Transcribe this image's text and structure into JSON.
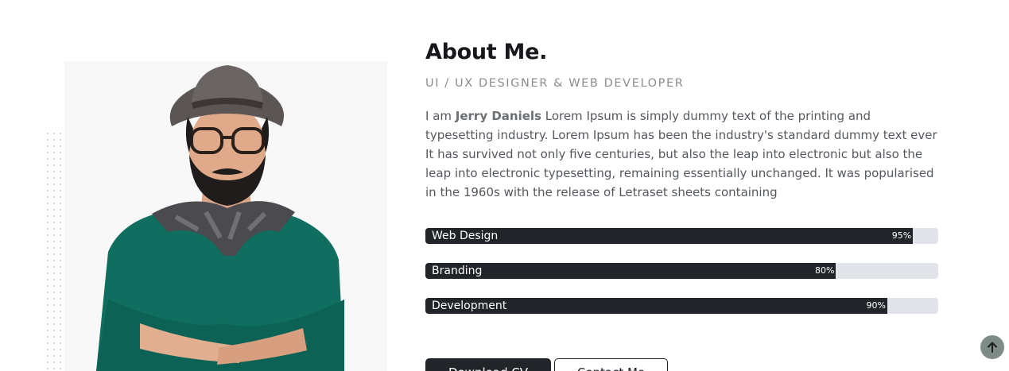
{
  "about": {
    "title": "About Me.",
    "subtitle": "UI / UX DESIGNER & WEB DEVELOPER",
    "bio_prefix": "I am ",
    "bio_name": "Jerry Daniels",
    "bio_text": " Lorem Ipsum is simply dummy text of the printing and typesetting industry. Lorem Ipsum has been the industry's standard dummy text ever It has survived not only five centuries, but also the leap into electronic but also the leap into electronic typesetting, remaining essentially unchanged. It was popularised in the 1960s with the release of Letraset sheets containing"
  },
  "skills": [
    {
      "label": "Web Design",
      "percent_label": "95%",
      "value": 0.95
    },
    {
      "label": "Branding",
      "percent_label": "80%",
      "value": 0.8
    },
    {
      "label": "Development",
      "percent_label": "90%",
      "value": 0.9
    }
  ],
  "buttons": {
    "download_cv": "Download CV",
    "contact_me": "Contact Me"
  },
  "icons": {
    "back_to_top": "arrow-up-icon"
  },
  "colors": {
    "dark": "#212529",
    "track": "#e1e4e8",
    "scroll_top": "#7d8c85"
  }
}
